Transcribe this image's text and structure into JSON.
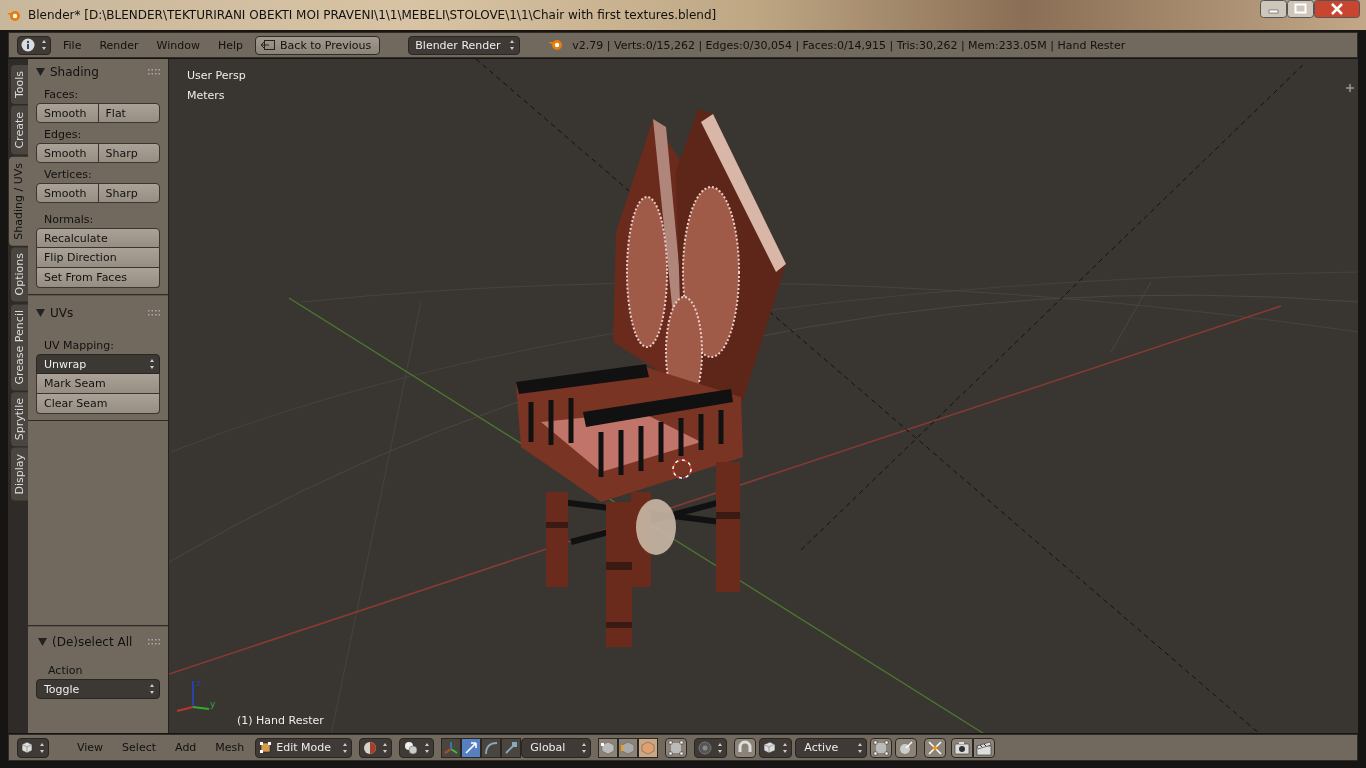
{
  "window": {
    "title": "Blender* [D:\\BLENDER\\TEKTURIRANI OBEKTI MOI PRAVENI\\1\\1\\MEBELI\\STOLOVE\\1\\1\\Chair with first textures.blend]"
  },
  "info_header": {
    "menus": [
      "File",
      "Render",
      "Window",
      "Help"
    ],
    "back_button": "Back to Previous",
    "render_engine": "Blender Render",
    "stats": "v2.79 | Verts:0/15,262 | Edges:0/30,054 | Faces:0/14,915 | Tris:30,262 | Mem:233.05M | Hand Rester"
  },
  "tool_tabs": [
    {
      "label": "Tools",
      "selected": false
    },
    {
      "label": "Create",
      "selected": false
    },
    {
      "label": "Shading / UVs",
      "selected": true
    },
    {
      "label": "Options",
      "selected": false
    },
    {
      "label": "Grease Pencil",
      "selected": false
    },
    {
      "label": "Sprytile",
      "selected": false
    },
    {
      "label": "Display",
      "selected": false
    }
  ],
  "shading_panel": {
    "title": "Shading",
    "groups": [
      {
        "kind": "row",
        "label": "Faces:",
        "buttons": [
          "Smooth",
          "Flat"
        ]
      },
      {
        "kind": "row",
        "label": "Edges:",
        "buttons": [
          "Smooth",
          "Sharp"
        ]
      },
      {
        "kind": "row",
        "label": "Vertices:",
        "buttons": [
          "Smooth",
          "Sharp"
        ]
      },
      {
        "kind": "column",
        "label": "Normals:",
        "buttons": [
          "Recalculate",
          "Flip Direction",
          "Set From Faces"
        ]
      }
    ]
  },
  "uvs_panel": {
    "title": "UVs",
    "label": "UV Mapping:",
    "dropdown": "Unwrap",
    "buttons": [
      "Mark Seam",
      "Clear Seam"
    ]
  },
  "operator_panel": {
    "title": "(De)select All",
    "label": "Action",
    "dropdown": "Toggle"
  },
  "viewport": {
    "view_name": "User Persp",
    "units": "Meters",
    "object_label": "(1) Hand Rester",
    "axis_labels": [
      "z",
      "y"
    ]
  },
  "view_header": {
    "menus": [
      "View",
      "Select",
      "Add",
      "Mesh"
    ],
    "mode": "Edit Mode",
    "manipulators": [
      {
        "kind": "combined",
        "selected": false
      },
      {
        "kind": "translate",
        "selected": true
      },
      {
        "kind": "rotate",
        "selected": false
      },
      {
        "kind": "scale",
        "selected": false
      }
    ],
    "orientation": "Global",
    "select_modes": [
      {
        "kind": "vertex",
        "selected": false
      },
      {
        "kind": "edge",
        "selected": false
      },
      {
        "kind": "face",
        "selected": true
      }
    ],
    "snap_target": "Active"
  }
}
